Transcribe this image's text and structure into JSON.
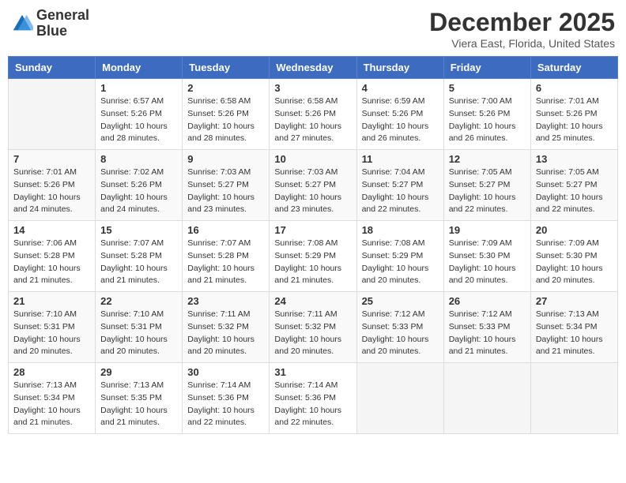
{
  "logo": {
    "line1": "General",
    "line2": "Blue"
  },
  "title": "December 2025",
  "subtitle": "Viera East, Florida, United States",
  "header_days": [
    "Sunday",
    "Monday",
    "Tuesday",
    "Wednesday",
    "Thursday",
    "Friday",
    "Saturday"
  ],
  "weeks": [
    [
      {
        "day": "",
        "info": ""
      },
      {
        "day": "1",
        "info": "Sunrise: 6:57 AM\nSunset: 5:26 PM\nDaylight: 10 hours\nand 28 minutes."
      },
      {
        "day": "2",
        "info": "Sunrise: 6:58 AM\nSunset: 5:26 PM\nDaylight: 10 hours\nand 28 minutes."
      },
      {
        "day": "3",
        "info": "Sunrise: 6:58 AM\nSunset: 5:26 PM\nDaylight: 10 hours\nand 27 minutes."
      },
      {
        "day": "4",
        "info": "Sunrise: 6:59 AM\nSunset: 5:26 PM\nDaylight: 10 hours\nand 26 minutes."
      },
      {
        "day": "5",
        "info": "Sunrise: 7:00 AM\nSunset: 5:26 PM\nDaylight: 10 hours\nand 26 minutes."
      },
      {
        "day": "6",
        "info": "Sunrise: 7:01 AM\nSunset: 5:26 PM\nDaylight: 10 hours\nand 25 minutes."
      }
    ],
    [
      {
        "day": "7",
        "info": "Sunrise: 7:01 AM\nSunset: 5:26 PM\nDaylight: 10 hours\nand 24 minutes."
      },
      {
        "day": "8",
        "info": "Sunrise: 7:02 AM\nSunset: 5:26 PM\nDaylight: 10 hours\nand 24 minutes."
      },
      {
        "day": "9",
        "info": "Sunrise: 7:03 AM\nSunset: 5:27 PM\nDaylight: 10 hours\nand 23 minutes."
      },
      {
        "day": "10",
        "info": "Sunrise: 7:03 AM\nSunset: 5:27 PM\nDaylight: 10 hours\nand 23 minutes."
      },
      {
        "day": "11",
        "info": "Sunrise: 7:04 AM\nSunset: 5:27 PM\nDaylight: 10 hours\nand 22 minutes."
      },
      {
        "day": "12",
        "info": "Sunrise: 7:05 AM\nSunset: 5:27 PM\nDaylight: 10 hours\nand 22 minutes."
      },
      {
        "day": "13",
        "info": "Sunrise: 7:05 AM\nSunset: 5:27 PM\nDaylight: 10 hours\nand 22 minutes."
      }
    ],
    [
      {
        "day": "14",
        "info": "Sunrise: 7:06 AM\nSunset: 5:28 PM\nDaylight: 10 hours\nand 21 minutes."
      },
      {
        "day": "15",
        "info": "Sunrise: 7:07 AM\nSunset: 5:28 PM\nDaylight: 10 hours\nand 21 minutes."
      },
      {
        "day": "16",
        "info": "Sunrise: 7:07 AM\nSunset: 5:28 PM\nDaylight: 10 hours\nand 21 minutes."
      },
      {
        "day": "17",
        "info": "Sunrise: 7:08 AM\nSunset: 5:29 PM\nDaylight: 10 hours\nand 21 minutes."
      },
      {
        "day": "18",
        "info": "Sunrise: 7:08 AM\nSunset: 5:29 PM\nDaylight: 10 hours\nand 20 minutes."
      },
      {
        "day": "19",
        "info": "Sunrise: 7:09 AM\nSunset: 5:30 PM\nDaylight: 10 hours\nand 20 minutes."
      },
      {
        "day": "20",
        "info": "Sunrise: 7:09 AM\nSunset: 5:30 PM\nDaylight: 10 hours\nand 20 minutes."
      }
    ],
    [
      {
        "day": "21",
        "info": "Sunrise: 7:10 AM\nSunset: 5:31 PM\nDaylight: 10 hours\nand 20 minutes."
      },
      {
        "day": "22",
        "info": "Sunrise: 7:10 AM\nSunset: 5:31 PM\nDaylight: 10 hours\nand 20 minutes."
      },
      {
        "day": "23",
        "info": "Sunrise: 7:11 AM\nSunset: 5:32 PM\nDaylight: 10 hours\nand 20 minutes."
      },
      {
        "day": "24",
        "info": "Sunrise: 7:11 AM\nSunset: 5:32 PM\nDaylight: 10 hours\nand 20 minutes."
      },
      {
        "day": "25",
        "info": "Sunrise: 7:12 AM\nSunset: 5:33 PM\nDaylight: 10 hours\nand 20 minutes."
      },
      {
        "day": "26",
        "info": "Sunrise: 7:12 AM\nSunset: 5:33 PM\nDaylight: 10 hours\nand 21 minutes."
      },
      {
        "day": "27",
        "info": "Sunrise: 7:13 AM\nSunset: 5:34 PM\nDaylight: 10 hours\nand 21 minutes."
      }
    ],
    [
      {
        "day": "28",
        "info": "Sunrise: 7:13 AM\nSunset: 5:34 PM\nDaylight: 10 hours\nand 21 minutes."
      },
      {
        "day": "29",
        "info": "Sunrise: 7:13 AM\nSunset: 5:35 PM\nDaylight: 10 hours\nand 21 minutes."
      },
      {
        "day": "30",
        "info": "Sunrise: 7:14 AM\nSunset: 5:36 PM\nDaylight: 10 hours\nand 22 minutes."
      },
      {
        "day": "31",
        "info": "Sunrise: 7:14 AM\nSunset: 5:36 PM\nDaylight: 10 hours\nand 22 minutes."
      },
      {
        "day": "",
        "info": ""
      },
      {
        "day": "",
        "info": ""
      },
      {
        "day": "",
        "info": ""
      }
    ]
  ]
}
